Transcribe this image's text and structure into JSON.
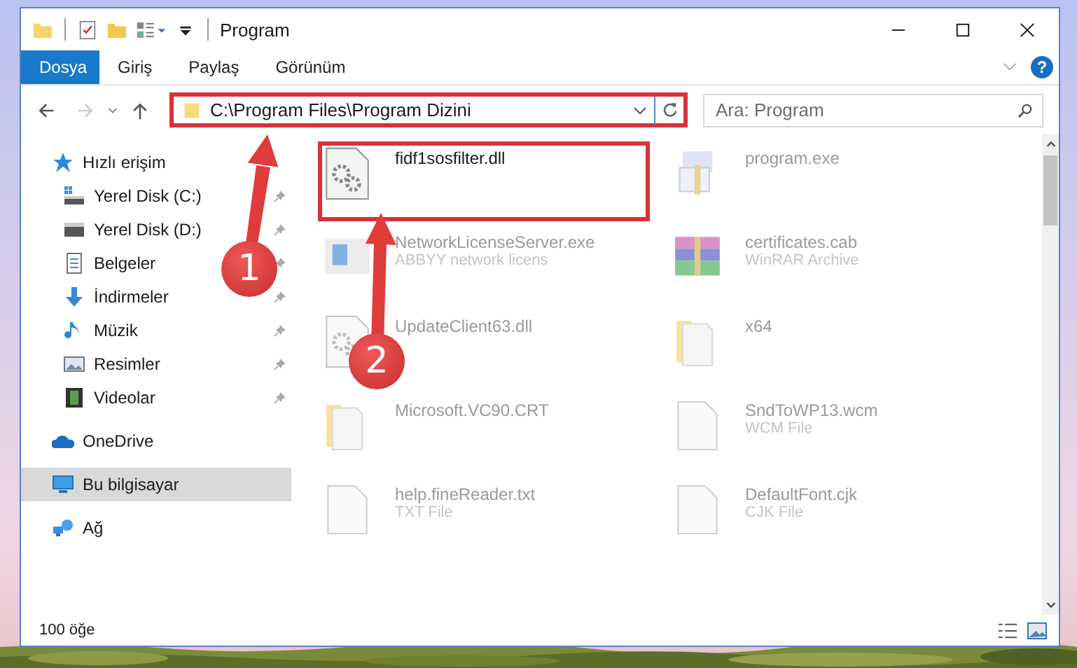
{
  "window": {
    "title": "Program"
  },
  "ribbon": {
    "tabs": [
      {
        "label": "Dosya",
        "selected": true
      },
      {
        "label": "Giriş",
        "selected": false
      },
      {
        "label": "Paylaş",
        "selected": false
      },
      {
        "label": "Görünüm",
        "selected": false
      }
    ],
    "help": "?"
  },
  "address": {
    "path": "C:\\Program Files\\Program Dizini",
    "highlighted": true
  },
  "search": {
    "placeholder": "Ara: Program"
  },
  "navigation": [
    {
      "label": "Hızlı erişim",
      "kind": "star",
      "selected": false,
      "children": [
        {
          "label": "Yerel Disk (C:)",
          "kind": "drive-c",
          "pinned": true
        },
        {
          "label": "Yerel Disk (D:)",
          "kind": "drive",
          "pinned": true
        },
        {
          "label": "Belgeler",
          "kind": "docs",
          "pinned": true
        },
        {
          "label": "İndirmeler",
          "kind": "download",
          "pinned": true
        },
        {
          "label": "Müzik",
          "kind": "music",
          "pinned": true
        },
        {
          "label": "Resimler",
          "kind": "pictures",
          "pinned": true
        },
        {
          "label": "Videolar",
          "kind": "video",
          "pinned": true
        }
      ]
    },
    {
      "label": "OneDrive",
      "kind": "cloud",
      "selected": false
    },
    {
      "label": "Bu bilgisayar",
      "kind": "computer",
      "selected": true
    },
    {
      "label": "Ağ",
      "kind": "network",
      "selected": false
    }
  ],
  "files": [
    {
      "name": "fidf1sosfilter.dll",
      "kind": "dll",
      "highlighted": true,
      "faded": false
    },
    {
      "name": "program.exe",
      "kind": "exe",
      "highlighted": false,
      "faded": true
    },
    {
      "name": "NetworkLicenseServer.exe",
      "detail": "ABBYY network licens",
      "kind": "app",
      "highlighted": false,
      "faded": true
    },
    {
      "name": "certificates.cab",
      "detail": "WinRAR Archive",
      "kind": "archive",
      "highlighted": false,
      "faded": true
    },
    {
      "name": "UpdateClient63.dll",
      "kind": "dll",
      "highlighted": false,
      "faded": true
    },
    {
      "name": "x64",
      "kind": "folder",
      "highlighted": false,
      "faded": true
    },
    {
      "name": "Microsoft.VC90.CRT",
      "kind": "folder",
      "highlighted": false,
      "faded": true
    },
    {
      "name": "SndToWP13.wcm",
      "detail": "WCM File",
      "kind": "file",
      "highlighted": false,
      "faded": true
    },
    {
      "name": "help.fineReader.txt",
      "detail": "TXT File",
      "kind": "file",
      "highlighted": false,
      "faded": true
    },
    {
      "name": "DefaultFont.cjk",
      "detail": "CJK File",
      "kind": "file",
      "highlighted": false,
      "faded": true
    }
  ],
  "annotations": [
    {
      "number": "1"
    },
    {
      "number": "2"
    }
  ],
  "status_bar": {
    "count": "100 öğe"
  }
}
